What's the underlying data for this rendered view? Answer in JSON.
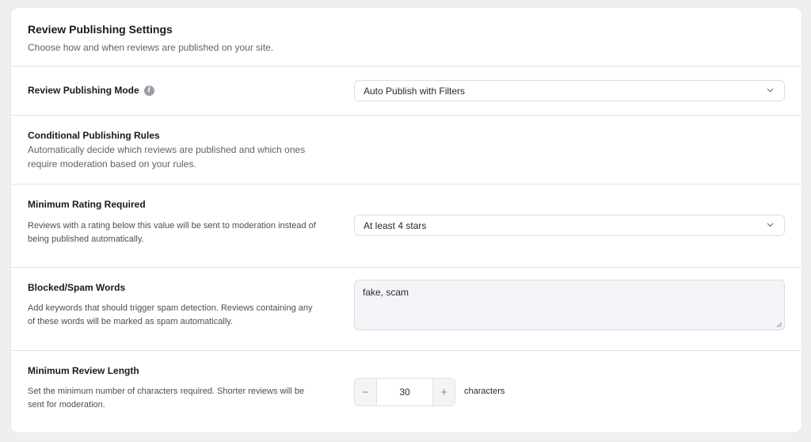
{
  "header": {
    "title": "Review Publishing Settings",
    "subtitle": "Choose how and when reviews are published on your site."
  },
  "publishing_mode": {
    "label": "Review Publishing Mode",
    "info_icon": "info-icon",
    "selected": "Auto Publish with Filters"
  },
  "conditional_rules": {
    "title": "Conditional Publishing Rules",
    "desc_line1": "Automatically decide which reviews are published and which ones",
    "desc_line2": "require moderation based on your rules."
  },
  "min_rating": {
    "label": "Minimum Rating Required",
    "desc_line1": "Reviews with a rating below this value will be sent to moderation instead of",
    "desc_line2": "being published automatically.",
    "selected": "At least 4 stars"
  },
  "spam_words": {
    "label": "Blocked/Spam Words",
    "desc_line1": "Add keywords that should trigger spam detection. Reviews containing any",
    "desc_line2": "of these words will be marked as spam automatically.",
    "value": "fake, scam"
  },
  "min_length": {
    "label": "Minimum Review Length",
    "desc_line1": "Set the minimum number of characters required. Shorter reviews will be",
    "desc_line2": "sent for moderation.",
    "minus": "−",
    "value": "30",
    "plus": "+",
    "suffix": "characters"
  }
}
